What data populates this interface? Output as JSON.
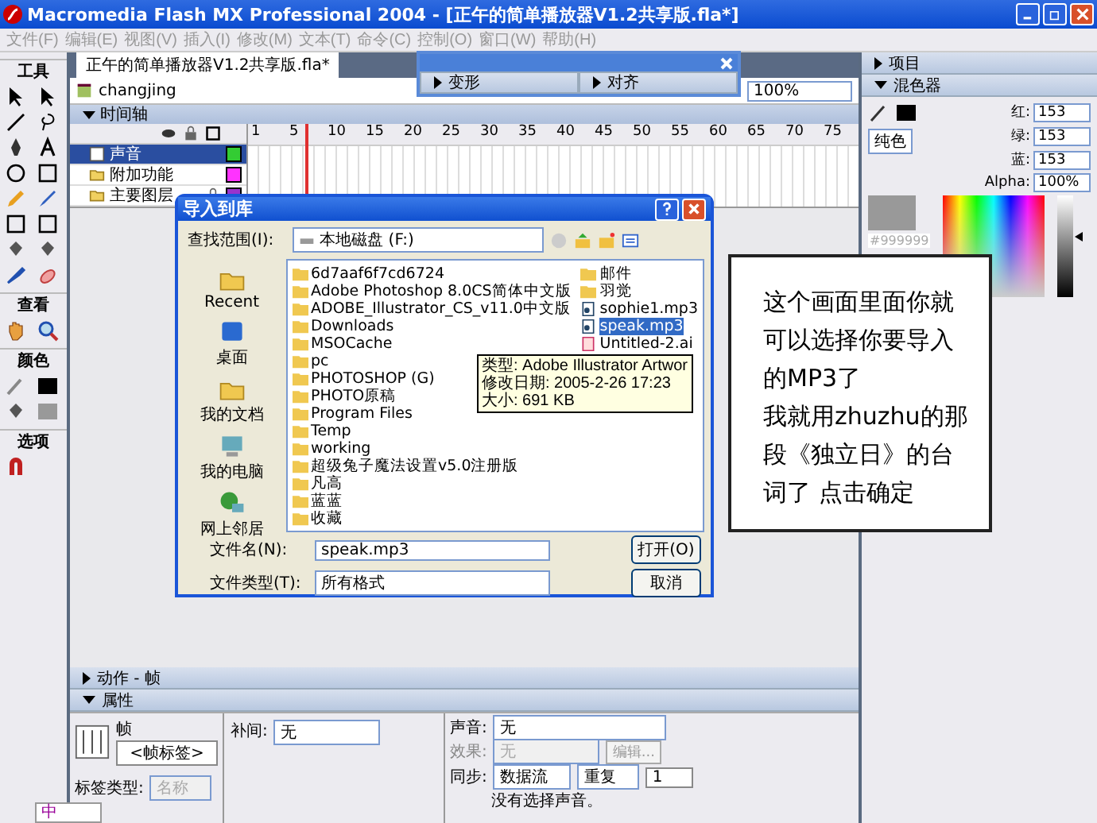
{
  "window": {
    "title": "Macromedia Flash MX Professional 2004 - [正午的简单播放器V1.2共享版.fla*]"
  },
  "menu": [
    {
      "label": "文件(F)",
      "disabled": true
    },
    {
      "label": "编辑(E)",
      "disabled": true
    },
    {
      "label": "视图(V)",
      "disabled": true
    },
    {
      "label": "插入(I)",
      "disabled": true
    },
    {
      "label": "修改(M)",
      "disabled": true
    },
    {
      "label": "文本(T)",
      "disabled": true
    },
    {
      "label": "命令(C)",
      "disabled": true
    },
    {
      "label": "控制(O)",
      "disabled": true
    },
    {
      "label": "窗口(W)",
      "disabled": true
    },
    {
      "label": "帮助(H)",
      "disabled": true
    }
  ],
  "tool_headings": [
    "工具",
    "查看",
    "颜色",
    "选项"
  ],
  "document": {
    "tab": "正午的简单播放器V1.2共享版.fla*",
    "scene": "changjing",
    "zoom": "100%"
  },
  "floating_panel": [
    {
      "label": "变形",
      "expanded": false
    },
    {
      "label": "对齐",
      "expanded": false
    }
  ],
  "timeline": {
    "title": "时间轴",
    "expanded": true,
    "frame_numbers": [
      "1",
      "5",
      "10",
      "15",
      "20",
      "25",
      "30",
      "35",
      "40",
      "45",
      "50",
      "55",
      "60",
      "65",
      "70",
      "75"
    ],
    "layers": [
      {
        "name": "声音",
        "kind": "layer",
        "selected": true,
        "locked": false,
        "color": "#33cc33"
      },
      {
        "name": "附加功能",
        "kind": "folder",
        "selected": false,
        "locked": false,
        "color": "#ff33ff"
      },
      {
        "name": "主要图层",
        "kind": "folder",
        "selected": false,
        "locked": true,
        "color": "#9933cc"
      }
    ]
  },
  "dialog": {
    "title": "导入到库",
    "look_in_label": "查找范围(I):",
    "look_in": "本地磁盘 (F:)",
    "places": [
      "Recent",
      "桌面",
      "我的文档",
      "我的电脑",
      "网上邻居"
    ],
    "files": [
      {
        "name": "6d7aaf6f7cd6724",
        "kind": "folder",
        "selected": false
      },
      {
        "name": "Adobe Photoshop 8.0CS简体中文版",
        "kind": "folder",
        "selected": false
      },
      {
        "name": "ADOBE_Illustrator_CS_v11.0中文版",
        "kind": "folder",
        "selected": false
      },
      {
        "name": "Downloads",
        "kind": "folder",
        "selected": false
      },
      {
        "name": "MSOCache",
        "kind": "folder",
        "selected": false
      },
      {
        "name": "pc",
        "kind": "folder",
        "selected": false
      },
      {
        "name": "PHOTOSHOP (G)",
        "kind": "folder",
        "selected": false
      },
      {
        "name": "PHOTO原稿",
        "kind": "folder",
        "selected": false
      },
      {
        "name": "Program Files",
        "kind": "folder",
        "selected": false
      },
      {
        "name": "Temp",
        "kind": "folder",
        "selected": false
      },
      {
        "name": "working",
        "kind": "folder",
        "selected": false
      },
      {
        "name": "超级兔子魔法设置v5.0注册版",
        "kind": "folder",
        "selected": false
      },
      {
        "name": "凡高",
        "kind": "folder",
        "selected": false
      },
      {
        "name": "蓝蓝",
        "kind": "folder",
        "selected": false
      },
      {
        "name": "收藏",
        "kind": "folder",
        "selected": false
      },
      {
        "name": "邮件",
        "kind": "folder",
        "selected": false
      },
      {
        "name": "羽觉",
        "kind": "folder",
        "selected": false
      },
      {
        "name": "sophie1.mp3",
        "kind": "audio",
        "selected": false
      },
      {
        "name": "speak.mp3",
        "kind": "audio",
        "selected": true
      },
      {
        "name": "Untitled-2.ai",
        "kind": "illustration",
        "selected": false
      }
    ],
    "tooltip": [
      "类型: Adobe Illustrator Artwor",
      "修改日期: 2005-2-26 17:23",
      "大小: 691 KB"
    ],
    "file_name_label": "文件名(N):",
    "file_name": "speak.mp3",
    "file_type_label": "文件类型(T):",
    "file_type": "所有格式",
    "buttons": [
      "打开(O)",
      "取消"
    ]
  },
  "note": {
    "paragraphs": [
      "这个画面里面你就可以选择你要导入的MP3了",
      "我就用zhuzhu的那段《独立日》的台词了 点击确定"
    ]
  },
  "right_panels": [
    {
      "title": "项目",
      "expanded": false
    },
    {
      "title": "混色器",
      "expanded": true
    }
  ],
  "mixer": {
    "fill_type": "纯色",
    "hex": "#999999",
    "brightness": {
      "level": 0.59
    },
    "channels": [
      {
        "label": "红:",
        "value": "153"
      },
      {
        "label": "绿:",
        "value": "153"
      },
      {
        "label": "蓝:",
        "value": "153"
      },
      {
        "label": "Alpha:",
        "value": "100%"
      }
    ]
  },
  "bottom_panels": [
    {
      "title": "动作 - 帧",
      "expanded": false
    },
    {
      "title": "属性",
      "expanded": true
    }
  ],
  "properties": {
    "frame_label": "帧",
    "frame_name_placeholder": "<帧标签>",
    "tween_label": "补间:",
    "tween": "无",
    "sound_label": "声音:",
    "sound": "无",
    "effect_label": "效果:",
    "effect": "无",
    "edit_button": "编辑...",
    "label_type_label": "标签类型:",
    "label_type": "名称",
    "sync_label": "同步:",
    "sync": "数据流",
    "repeat": "重复",
    "repeat_count": "1",
    "status": "没有选择声音。"
  },
  "ime_bar": {
    "label": "中"
  }
}
